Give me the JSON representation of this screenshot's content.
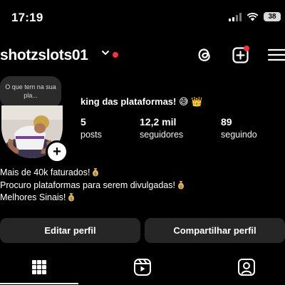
{
  "status_bar": {
    "time": "17:19",
    "battery": "38"
  },
  "header": {
    "username": "shotzslots01"
  },
  "profile": {
    "note": "O que tem na sua pla...",
    "display_name": "king das plataformas! 😅 👑",
    "stats": [
      {
        "value": "5",
        "label": "posts"
      },
      {
        "value": "12,2 mil",
        "label": "seguidores"
      },
      {
        "value": "89",
        "label": "seguindo"
      }
    ],
    "bio": [
      "Mais de 40k faturados!",
      "Procuro plataformas para serem divulgadas!",
      "Melhores Sinais!"
    ]
  },
  "actions": {
    "edit": "Editar perfil",
    "share": "Compartilhar perfil"
  },
  "tabs": [
    "grid-icon",
    "reels-icon",
    "tagged-icon"
  ],
  "colors": {
    "notification": "#ff3040",
    "button_bg": "#262626",
    "background": "#000000"
  }
}
